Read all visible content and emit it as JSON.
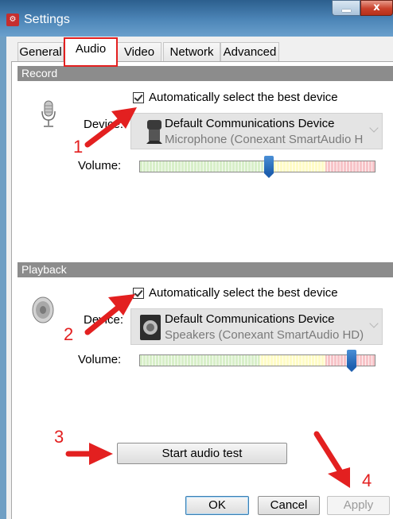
{
  "window": {
    "title": "Settings",
    "icon": "settings-app-icon",
    "buttons": {
      "minimize": "_",
      "close": "x"
    }
  },
  "tabs": [
    {
      "label": "General",
      "active": false
    },
    {
      "label": "Audio",
      "active": true
    },
    {
      "label": "Video",
      "active": false
    },
    {
      "label": "Network",
      "active": false
    },
    {
      "label": "Advanced",
      "active": false
    }
  ],
  "record": {
    "header": "Record",
    "auto_select_label": "Automatically select the best device",
    "auto_select_checked": true,
    "device_label": "Device:",
    "device_name": "Default Communications Device",
    "device_sub": "Microphone (Conexant SmartAudio H",
    "volume_label": "Volume:",
    "volume_level_percent": 55,
    "icon": "microphone-icon"
  },
  "playback": {
    "header": "Playback",
    "auto_select_label": "Automatically select the best device",
    "auto_select_checked": true,
    "device_label": "Device:",
    "device_name": "Default Communications Device",
    "device_sub": "Speakers (Conexant SmartAudio HD)",
    "volume_label": "Volume:",
    "volume_level_percent": 90,
    "icon": "speaker-icon"
  },
  "start_audio_test_label": "Start audio test",
  "footer": {
    "ok_label": "OK",
    "cancel_label": "Cancel",
    "apply_label": "Apply",
    "apply_enabled": false
  },
  "annotations": [
    "1",
    "2",
    "3",
    "4"
  ],
  "colors": {
    "annotation": "#e32020",
    "section_header": "#8c8c8c",
    "slider_thumb": "#1d5fae"
  }
}
